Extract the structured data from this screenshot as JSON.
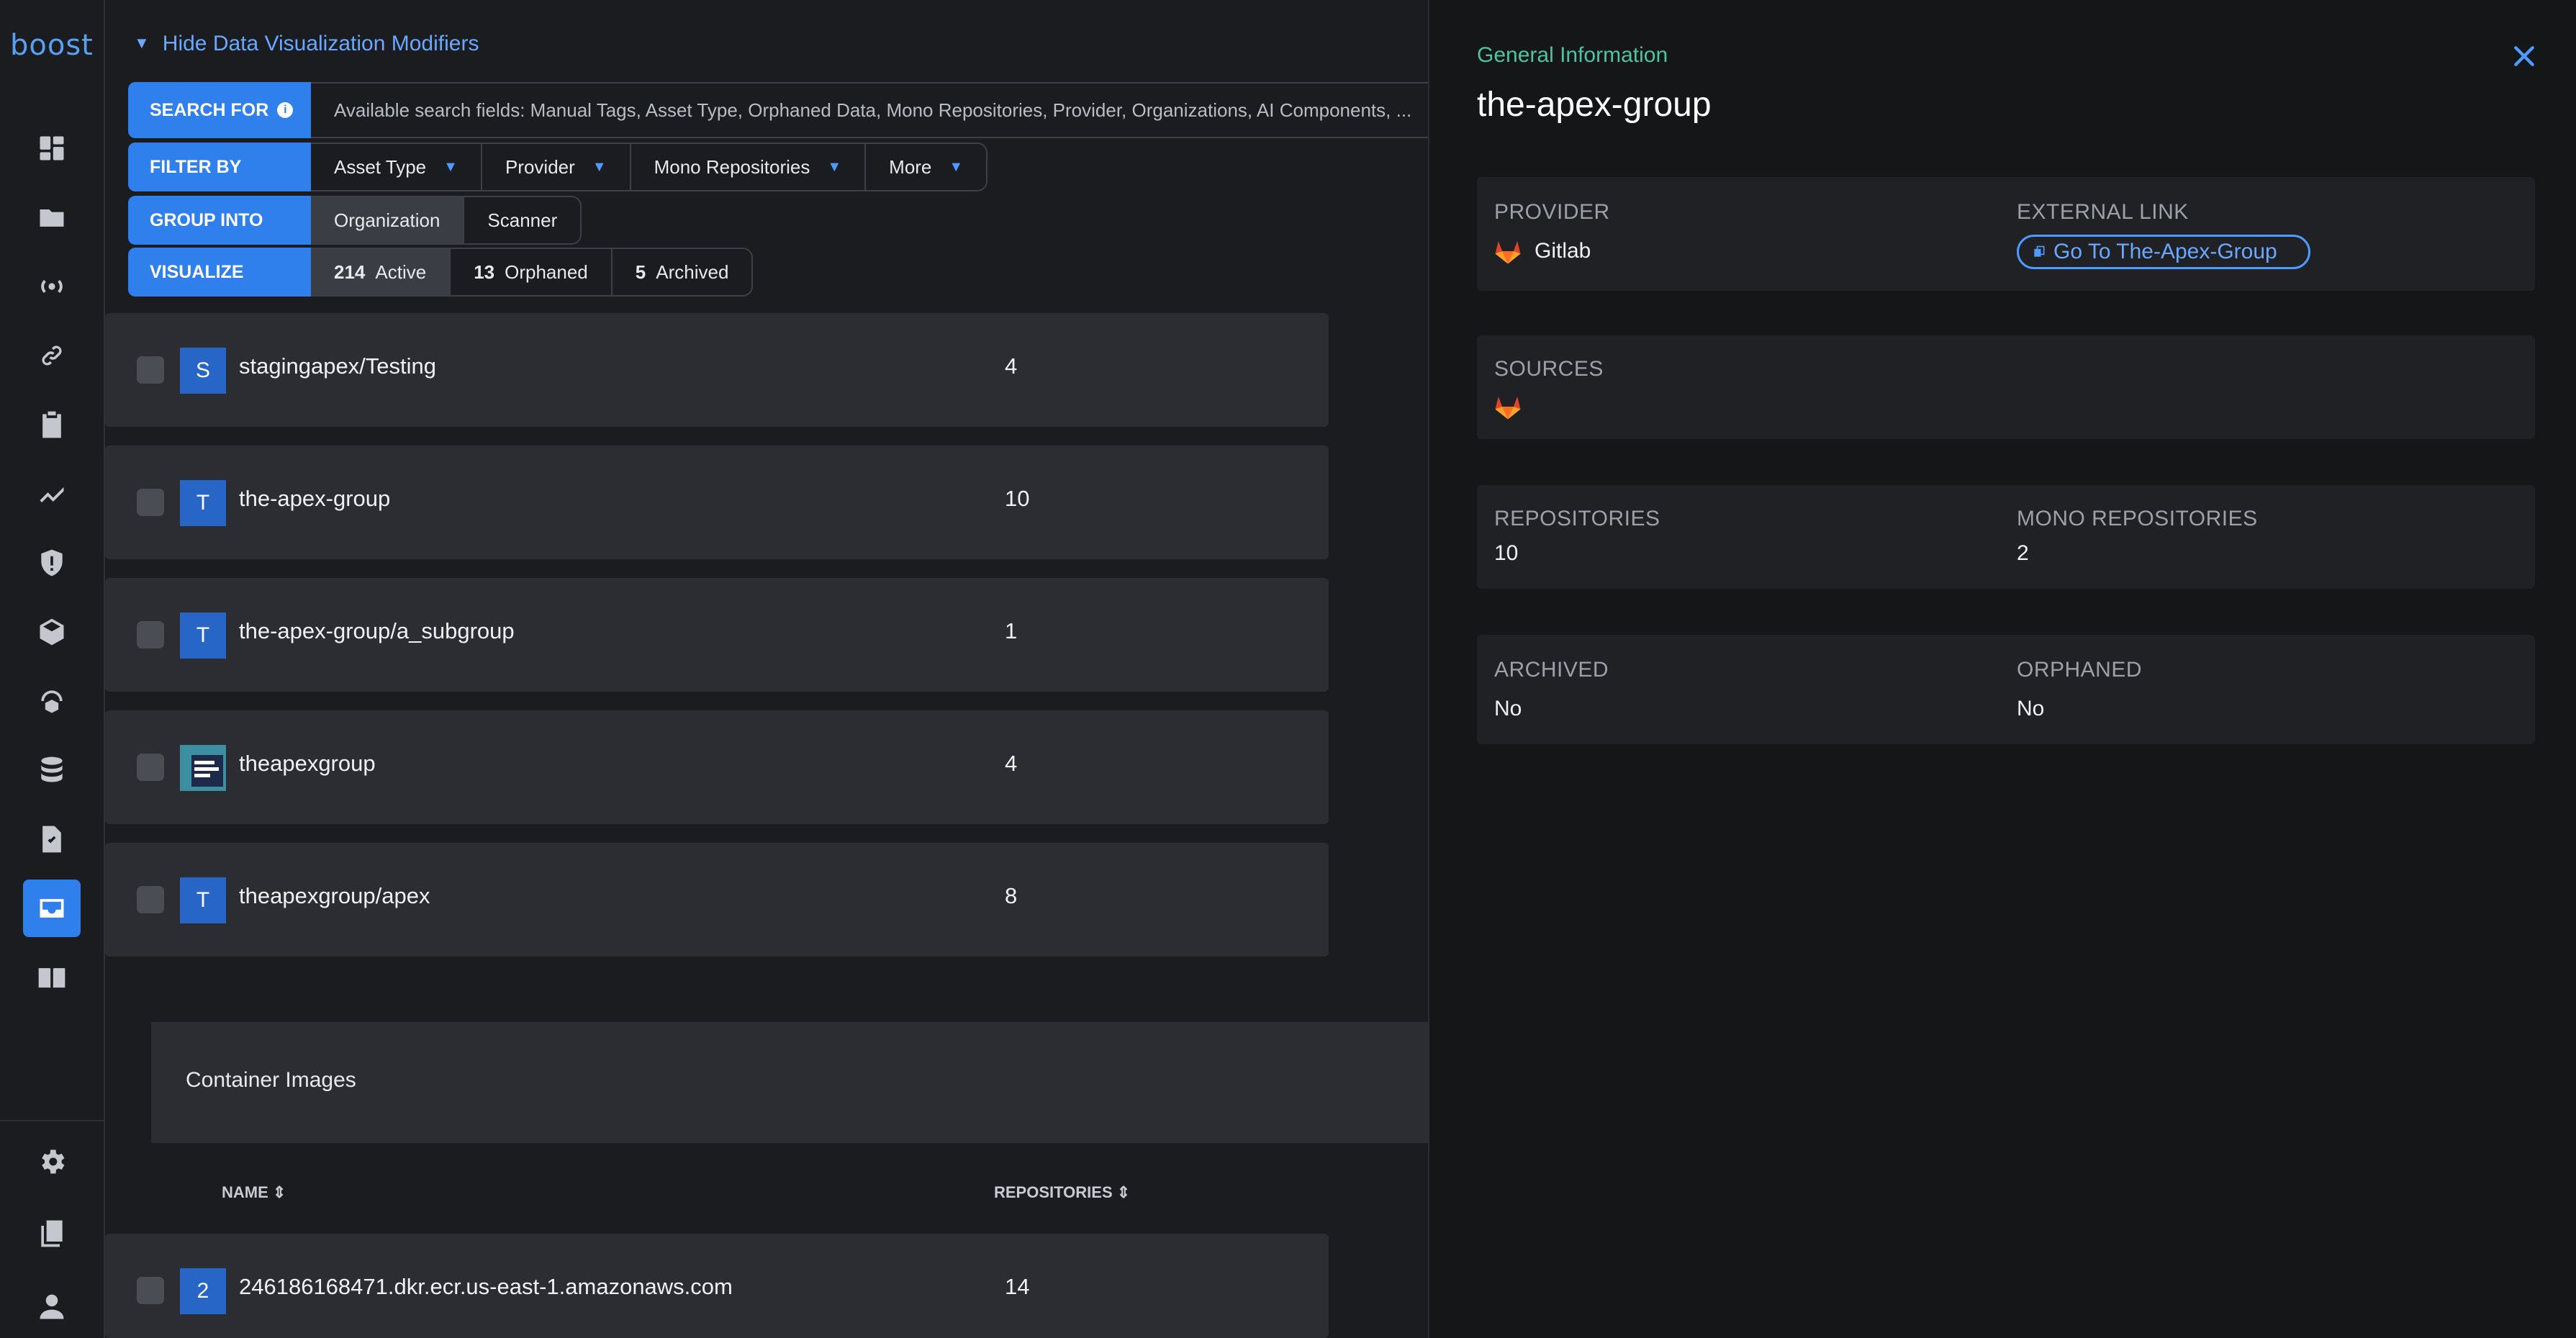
{
  "app": {
    "logo": "boost"
  },
  "sidebar": {
    "icons": [
      "dashboard-icon",
      "folder-icon",
      "broadcast-icon",
      "link-icon",
      "clipboard-icon",
      "trend-icon",
      "shield-icon",
      "cube-icon",
      "cloud-package-icon",
      "database-icon",
      "document-check-icon",
      "inbox-icon",
      "book-icon",
      "gear-icon",
      "copy-icon",
      "user-icon"
    ],
    "active": "inbox-icon"
  },
  "modifiers": {
    "toggle_label": "Hide Data Visualization Modifiers",
    "search": {
      "label": "SEARCH FOR",
      "text": "Available search fields: Manual Tags, Asset Type, Orphaned Data, Mono Repositories, Provider, Organizations, AI Components, ..."
    },
    "filter": {
      "label": "FILTER BY",
      "options": [
        "Asset Type",
        "Provider",
        "Mono Repositories",
        "More"
      ]
    },
    "group": {
      "label": "GROUP INTO",
      "options": [
        "Organization",
        "Scanner"
      ],
      "selected": "Organization"
    },
    "visualize": {
      "label": "VISUALIZE",
      "options": [
        {
          "count": "214",
          "label": "Active"
        },
        {
          "count": "13",
          "label": "Orphaned"
        },
        {
          "count": "5",
          "label": "Archived"
        }
      ]
    }
  },
  "orgs": [
    {
      "avatar": "S",
      "name": "stagingapex/Testing",
      "count": "4"
    },
    {
      "avatar": "T",
      "name": "the-apex-group",
      "count": "10"
    },
    {
      "avatar": "T",
      "name": "the-apex-group/a_subgroup",
      "count": "1"
    },
    {
      "avatar": "",
      "name": "theapexgroup",
      "count": "4"
    },
    {
      "avatar": "T",
      "name": "theapexgroup/apex",
      "count": "8"
    }
  ],
  "container_images": {
    "title": "Container Images",
    "columns": [
      "NAME ⇕",
      "REPOSITORIES ⇕"
    ],
    "rows": [
      {
        "avatar": "2",
        "name": "246186168471.dkr.ecr.us-east-1.amazonaws.com",
        "count": "14"
      }
    ]
  },
  "panel": {
    "subtitle": "General Information",
    "title": "the-apex-group",
    "provider_label": "PROVIDER",
    "provider_value": "Gitlab",
    "external_label": "EXTERNAL LINK",
    "external_link": "Go To The-Apex-Group",
    "sources_label": "SOURCES",
    "repos_label": "REPOSITORIES",
    "repos_value": "10",
    "mono_label": "MONO REPOSITORIES",
    "mono_value": "2",
    "archived_label": "ARCHIVED",
    "archived_value": "No",
    "orphaned_label": "ORPHANED",
    "orphaned_value": "No"
  },
  "colors": {
    "accent": "#2f80ed",
    "link": "#6aa8ff",
    "subtitle": "#4fc3a1",
    "gitlab": "#e2432a"
  }
}
